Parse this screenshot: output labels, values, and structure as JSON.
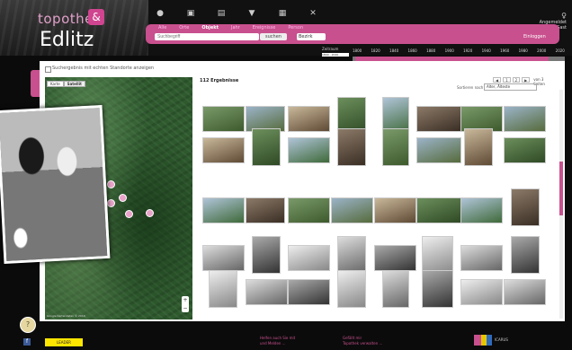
{
  "brand": {
    "logo_text": "topothek",
    "logo_mark": "&",
    "place": "Edlitz"
  },
  "nav": {
    "icons": [
      "home-icon",
      "archive-icon",
      "grid-icon",
      "filter-icon",
      "calendar-icon",
      "tools-icon"
    ],
    "glyphs": [
      "●",
      "▣",
      "▤",
      "▼",
      "▦",
      "✕"
    ],
    "user_glyph": "♀",
    "user_lines": [
      "Angemeldet",
      "als Gast"
    ]
  },
  "search": {
    "tabs": [
      "Alle",
      "Orte",
      "Objekt",
      "Jahr",
      "Ereignisse",
      "Person"
    ],
    "active_tab": 2,
    "placeholder": "Suchbegriff",
    "submit_label": "suchen",
    "region_label": "Bezirk",
    "login_label": "Einloggen"
  },
  "timebar": {
    "label": "Zeitraum",
    "value": "1800 - 2020",
    "years": [
      "1800",
      "1820",
      "1840",
      "1860",
      "1880",
      "1900",
      "1920",
      "1940",
      "1960",
      "1980",
      "2000",
      "2020"
    ],
    "start_tag": "1930",
    "end_tag": "2020"
  },
  "filters": {
    "geo_only_label": "Suchergebnis mit echten Standorte anzeigen"
  },
  "map": {
    "toggle": [
      "Karte",
      "Satellit"
    ],
    "active_toggle": 1,
    "credit": "Google Kartendaten © 2019",
    "zoom": [
      "+",
      "−"
    ],
    "pages": "◀ ▶"
  },
  "results": {
    "title": "112 Ergebnisse",
    "sort_label": "Sortieren nach",
    "sort_value": "Alter, Älteste",
    "pager": [
      "◀",
      "1",
      "2",
      "▶",
      "von 3 Seiten"
    ]
  },
  "footer": {
    "help": "?",
    "facebook": "f",
    "sponsor": "LEADER",
    "link1": [
      "Helfen auch Sie mit",
      "und Melden ..."
    ],
    "link2": [
      "Gefällt mir",
      "Topothek verwalten ..."
    ],
    "partner": "ICARUS"
  }
}
